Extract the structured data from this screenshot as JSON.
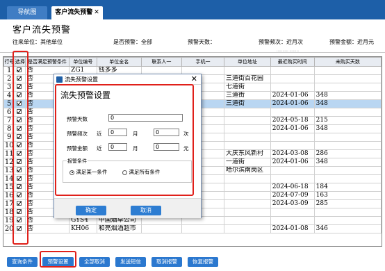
{
  "tabs": [
    {
      "label": "导航图"
    },
    {
      "label": "客户流失预警",
      "close": "✕"
    }
  ],
  "page_title": "客户流失预警",
  "filters": {
    "unit": "往来单位：其他单位",
    "alert": "是否预警：全部",
    "days": "预警天数：",
    "freq": "预警频次：近月次",
    "amount": "预警金额：近月元"
  },
  "grid": {
    "columns": [
      "行号",
      "选择",
      "是否满足预警条件",
      "单位编号",
      "单位全名",
      "联系人一",
      "手机一",
      "单位地址",
      "最近购买时间",
      "未购买天数"
    ],
    "rows": [
      {
        "no": "1",
        "checked": true,
        "ok": "否",
        "code": "ZG1",
        "name": "钱多多",
        "contact": "",
        "phone": "",
        "addr": "",
        "date": "",
        "days": ""
      },
      {
        "no": "2",
        "checked": true,
        "ok": "否",
        "code": "",
        "name": "",
        "contact": "",
        "phone": "",
        "addr": "三道街百花园",
        "date": "",
        "days": ""
      },
      {
        "no": "3",
        "checked": true,
        "ok": "否",
        "code": "",
        "name": "",
        "contact": "",
        "phone": "",
        "addr": "七道街",
        "date": "",
        "days": ""
      },
      {
        "no": "4",
        "checked": true,
        "ok": "否",
        "code": "",
        "name": "",
        "contact": "",
        "phone": "",
        "addr": "三道街",
        "date": "2024-01-06",
        "days": "348"
      },
      {
        "no": "5",
        "checked": true,
        "ok": "否",
        "code": "",
        "name": "",
        "contact": "",
        "phone": "",
        "addr": "三道街",
        "date": "2024-01-06",
        "days": "348",
        "selected": true
      },
      {
        "no": "6",
        "checked": true,
        "ok": "否",
        "code": "",
        "name": "",
        "contact": "",
        "phone": "",
        "addr": "",
        "date": "",
        "days": ""
      },
      {
        "no": "7",
        "checked": true,
        "ok": "否",
        "code": "",
        "name": "",
        "contact": "",
        "phone": "",
        "addr": "",
        "date": "2024-05-18",
        "days": "215"
      },
      {
        "no": "8",
        "checked": true,
        "ok": "否",
        "code": "",
        "name": "",
        "contact": "",
        "phone": "",
        "addr": "",
        "date": "2024-01-06",
        "days": "348"
      },
      {
        "no": "9",
        "checked": true,
        "ok": "否",
        "code": "",
        "name": "",
        "contact": "",
        "phone": "",
        "addr": "",
        "date": "",
        "days": ""
      },
      {
        "no": "10",
        "checked": true,
        "ok": "否",
        "code": "",
        "name": "",
        "contact": "",
        "phone": "",
        "addr": "",
        "date": "",
        "days": ""
      },
      {
        "no": "11",
        "checked": true,
        "ok": "否",
        "code": "",
        "name": "",
        "contact": "",
        "phone": "",
        "addr": "大庆东风新村",
        "date": "2024-03-08",
        "days": "286"
      },
      {
        "no": "12",
        "checked": true,
        "ok": "否",
        "code": "",
        "name": "",
        "contact": "",
        "phone": "",
        "addr": "一道街",
        "date": "2024-01-06",
        "days": "348"
      },
      {
        "no": "13",
        "checked": true,
        "ok": "否",
        "code": "",
        "name": "",
        "contact": "",
        "phone": "",
        "addr": "哈尔滨南岗区",
        "date": "",
        "days": ""
      },
      {
        "no": "14",
        "checked": true,
        "ok": "否",
        "code": "",
        "name": "",
        "contact": "",
        "phone": "",
        "addr": "",
        "date": "",
        "days": ""
      },
      {
        "no": "15",
        "checked": true,
        "ok": "否",
        "code": "",
        "name": "",
        "contact": "",
        "phone": "",
        "addr": "",
        "date": "2024-06-18",
        "days": "184"
      },
      {
        "no": "16",
        "checked": true,
        "ok": "否",
        "code": "",
        "name": "",
        "contact": "",
        "phone": "",
        "addr": "",
        "date": "2024-07-09",
        "days": "163"
      },
      {
        "no": "17",
        "checked": true,
        "ok": "否",
        "code": "",
        "name": "",
        "contact": "",
        "phone": "",
        "addr": "",
        "date": "2024-03-09",
        "days": "285"
      },
      {
        "no": "18",
        "checked": true,
        "ok": "否",
        "code": "",
        "name": "",
        "contact": "",
        "phone": "",
        "addr": "",
        "date": "",
        "days": ""
      },
      {
        "no": "19",
        "checked": true,
        "ok": "否",
        "code": "GYS4",
        "name": "中国烟草公司",
        "contact": "",
        "phone": "",
        "addr": "",
        "date": "",
        "days": ""
      },
      {
        "no": "20",
        "checked": true,
        "ok": "否",
        "code": "KH06",
        "name": "和亮烟酒超市",
        "contact": "",
        "phone": "",
        "addr": "",
        "date": "2024-01-08",
        "days": "346"
      }
    ]
  },
  "dialog": {
    "title": "流失预警设置",
    "close": "✕",
    "heading": "流失预警设置",
    "days_label": "预警天数",
    "days_value": "0",
    "freq_label": "预警频次",
    "freq_near": "近",
    "freq_value1": "0",
    "freq_unit1": "月",
    "freq_value2": "0",
    "freq_unit2": "次",
    "amount_label": "预警金额",
    "amount_near": "近",
    "amount_value1": "0",
    "amount_unit1": "月",
    "amount_value2": "0",
    "amount_unit2": "元",
    "condition_label": "报警条件",
    "cond_any": "满足某一条件",
    "cond_all": "满足所有条件",
    "ok": "确定",
    "cancel": "取消"
  },
  "toolbar": {
    "buttons": [
      "查询条件",
      "预警设置",
      "全部取消",
      "发送短信",
      "取消报警",
      "恢复报警"
    ]
  },
  "colors": {
    "header_blue": "#1d5fa8",
    "button_blue": "#2b78cf",
    "highlight_red": "#e0201a",
    "selected_row": "#b9d6f2"
  }
}
